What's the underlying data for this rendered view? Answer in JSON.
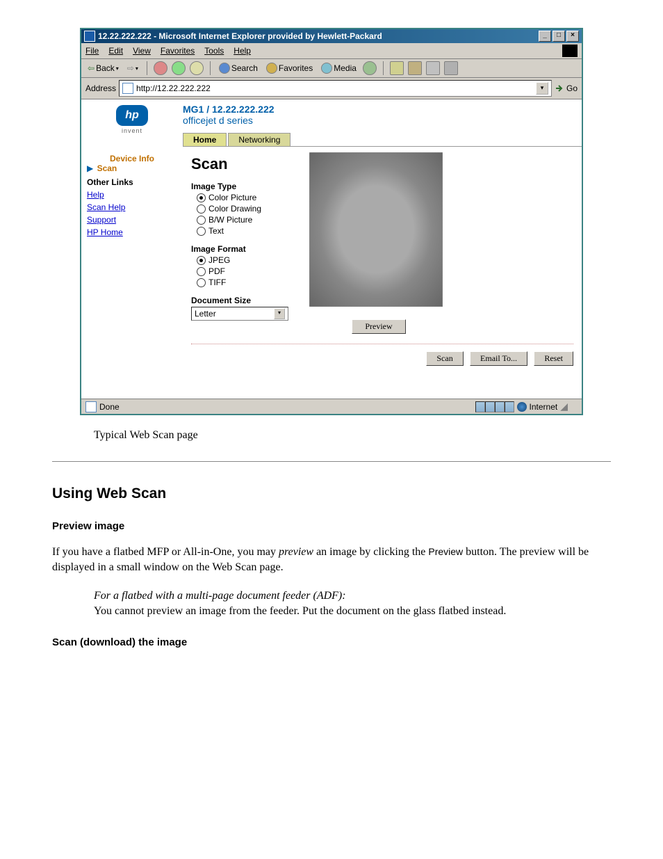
{
  "window": {
    "title": "12.22.222.222 - Microsoft Internet Explorer provided by Hewlett-Packard",
    "min": "_",
    "max": "□",
    "close": "×"
  },
  "menus": {
    "file": "File",
    "edit": "Edit",
    "view": "View",
    "favorites": "Favorites",
    "tools": "Tools",
    "help": "Help"
  },
  "toolbar": {
    "back": "Back",
    "search": "Search",
    "favorites": "Favorites",
    "media": "Media"
  },
  "address": {
    "label": "Address",
    "url": "http://12.22.222.222",
    "go": "Go"
  },
  "hp": {
    "logo": "hp",
    "tag": "invent"
  },
  "device": {
    "title": "MG1 / 12.22.222.222",
    "series": "officejet d series"
  },
  "tabs": {
    "home": "Home",
    "networking": "Networking"
  },
  "sidebar": {
    "device_info": "Device Info",
    "scan": "Scan",
    "other_links": "Other Links",
    "links": {
      "help": "Help",
      "scan_help": "Scan Help",
      "support": "Support",
      "hp_home": "HP Home"
    }
  },
  "scan": {
    "heading": "Scan",
    "image_type": {
      "label": "Image Type",
      "options": {
        "color_picture": "Color Picture",
        "color_drawing": "Color Drawing",
        "bw_picture": "B/W Picture",
        "text": "Text"
      },
      "selected": "color_picture"
    },
    "image_format": {
      "label": "Image Format",
      "options": {
        "jpeg": "JPEG",
        "pdf": "PDF",
        "tiff": "TIFF"
      },
      "selected": "jpeg"
    },
    "document_size": {
      "label": "Document Size",
      "value": "Letter"
    },
    "buttons": {
      "preview": "Preview",
      "scan": "Scan",
      "email": "Email To...",
      "reset": "Reset"
    }
  },
  "status": {
    "left": "Done",
    "zone": "Internet"
  },
  "caption": "Typical Web Scan page",
  "doc": {
    "h2": "Using Web Scan",
    "h3a": "Preview image",
    "p1a": "If you have a flatbed MFP or All-in-One, you may ",
    "p1b": "preview",
    "p1c": " an image by clicking the ",
    "p1d": "Preview",
    "p1e": " button. The preview will be displayed in a small window on the Web Scan page.",
    "note_h": "For a flatbed with a multi-page document feeder (ADF):",
    "note_b": "You cannot preview an image from the feeder. Put the document on the glass flatbed instead.",
    "h3b": "Scan (download) the image"
  }
}
